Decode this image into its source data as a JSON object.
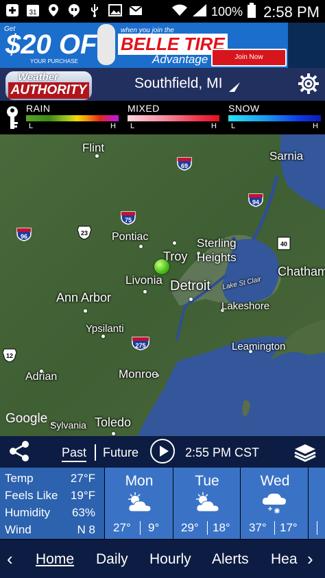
{
  "status_bar": {
    "battery": "100%",
    "time": "2:58 PM",
    "calendar_day": "31"
  },
  "ad": {
    "get": "Get",
    "amount": "$20 OFF",
    "your_purchase": "YOUR PURCHASE",
    "when_you_join": "when you join the",
    "brand": "BELLE TIRE",
    "advantage": "Advantage",
    "join_now": "Join Now"
  },
  "header": {
    "logo_top": "Weather",
    "logo_bottom": "AUTHORITY",
    "location": "Southfield, MI"
  },
  "legend": {
    "rain": {
      "label": "RAIN",
      "low": "L",
      "high": "H"
    },
    "mixed": {
      "label": "MIXED",
      "low": "L",
      "high": "H"
    },
    "snow": {
      "label": "SNOW",
      "low": "L",
      "high": "H"
    }
  },
  "map": {
    "cities": {
      "flint": "Flint",
      "sarnia": "Sarnia",
      "pontiac": "Pontiac",
      "sterling_heights": "Sterling Heights",
      "troy": "Troy",
      "livonia": "Livonia",
      "detroit": "Detroit",
      "chatham": "Chatham",
      "ann_arbor": "Ann Arbor",
      "lake_st_clair": "Lake St Clair",
      "lakeshore": "Lakeshore",
      "ypsilanti": "Ypsilanti",
      "leamington": "Leamington",
      "adrian": "Adrian",
      "monroe": "Monroe",
      "sylvania": "Sylvania",
      "toledo": "Toledo"
    },
    "highways": {
      "i69": "69",
      "i94": "94",
      "i96": "96",
      "us23": "23",
      "i75": "75",
      "on40": "40",
      "i275": "275",
      "us12": "12"
    },
    "attribution": "Google"
  },
  "controls": {
    "past": "Past",
    "future": "Future",
    "time": "2:55 PM CST"
  },
  "conditions": {
    "temp_label": "Temp",
    "temp": "27°F",
    "feels_label": "Feels Like",
    "feels": "19°F",
    "humidity_label": "Humidity",
    "humidity": "63%",
    "wind_label": "Wind",
    "wind": "N 8"
  },
  "forecast": [
    {
      "day": "Mon",
      "hi": "27°",
      "lo": "9°",
      "icon": "partly-cloudy-icon"
    },
    {
      "day": "Tue",
      "hi": "29°",
      "lo": "18°",
      "icon": "partly-cloudy-icon"
    },
    {
      "day": "Wed",
      "hi": "37°",
      "lo": "17°",
      "icon": "snow-cloud-icon"
    }
  ],
  "nav": {
    "home": "Home",
    "daily": "Daily",
    "hourly": "Hourly",
    "alerts": "Alerts",
    "partial": "Hea"
  },
  "colors": {
    "header_bg": "#22305f",
    "nav_bg": "#0d1c42",
    "conditions_bg": "#2c62ae",
    "forecast_bg": "#3a73c6",
    "pin": "#4cc21a"
  }
}
